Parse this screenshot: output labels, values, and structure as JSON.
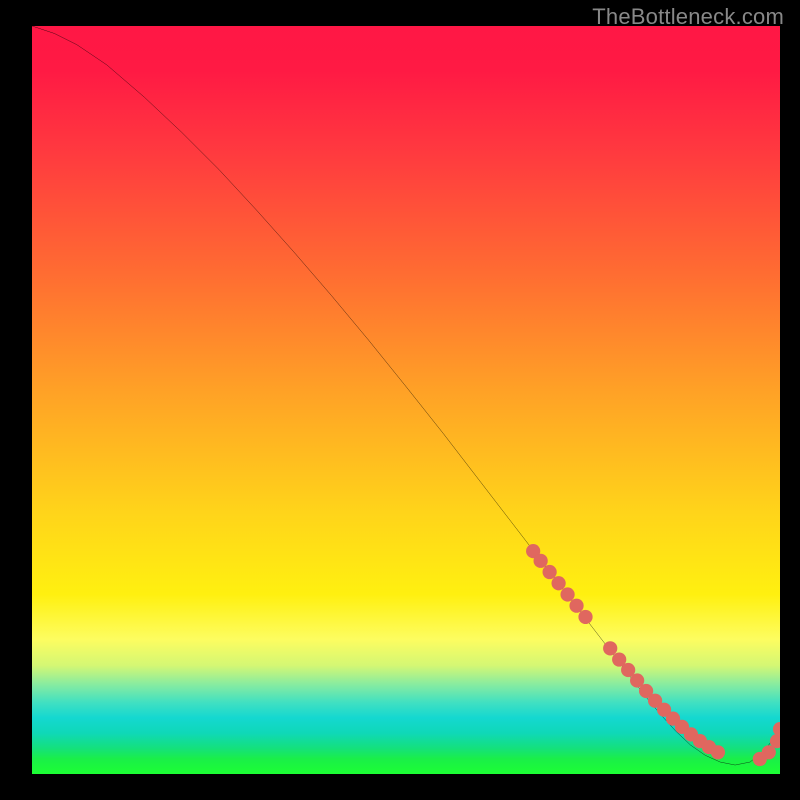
{
  "watermark": "TheBottleneck.com",
  "chart_data": {
    "type": "line",
    "title": "",
    "xlabel": "",
    "ylabel": "",
    "xlim": [
      0,
      100
    ],
    "ylim": [
      0,
      100
    ],
    "grid": false,
    "legend": false,
    "series": [
      {
        "name": "curve",
        "x": [
          0,
          3,
          6,
          10,
          15,
          20,
          25,
          30,
          35,
          40,
          45,
          50,
          55,
          60,
          62,
          64,
          66,
          68,
          70,
          72,
          74,
          76,
          78,
          80,
          82,
          84,
          86,
          88,
          90,
          92,
          94,
          96,
          98,
          100
        ],
        "y": [
          100,
          99,
          97.5,
          94.8,
          90.5,
          85.8,
          80.8,
          75.4,
          69.8,
          64.0,
          58.0,
          51.8,
          45.5,
          39.0,
          36.4,
          33.8,
          31.2,
          28.6,
          26.0,
          23.4,
          20.8,
          18.2,
          15.6,
          13.0,
          10.4,
          8.0,
          5.8,
          3.9,
          2.5,
          1.6,
          1.2,
          1.6,
          3.2,
          6.0
        ]
      },
      {
        "name": "dots",
        "x": [
          67.0,
          68.0,
          69.2,
          70.4,
          71.6,
          72.8,
          74.0,
          77.3,
          78.5,
          79.7,
          80.9,
          82.1,
          83.3,
          84.5,
          85.7,
          86.9,
          88.1,
          89.3,
          90.5,
          91.7,
          97.3,
          98.5,
          99.6,
          100.0
        ],
        "y": [
          29.8,
          28.5,
          27.0,
          25.5,
          24.0,
          22.5,
          21.0,
          16.8,
          15.3,
          13.9,
          12.5,
          11.1,
          9.8,
          8.6,
          7.4,
          6.3,
          5.3,
          4.4,
          3.6,
          2.9,
          2.0,
          2.9,
          4.4,
          6.0
        ]
      }
    ],
    "background_gradient": {
      "direction": "vertical",
      "stops": [
        {
          "pos": 0.0,
          "color": "#ff1745"
        },
        {
          "pos": 0.33,
          "color": "#ff6c32"
        },
        {
          "pos": 0.65,
          "color": "#ffd41a"
        },
        {
          "pos": 0.82,
          "color": "#fdfd60"
        },
        {
          "pos": 0.9,
          "color": "#3fe0c2"
        },
        {
          "pos": 1.0,
          "color": "#1cff34"
        }
      ]
    },
    "colors": {
      "curve": "#000000",
      "dots": "#e0675f",
      "frame_bg": "#000000"
    }
  }
}
